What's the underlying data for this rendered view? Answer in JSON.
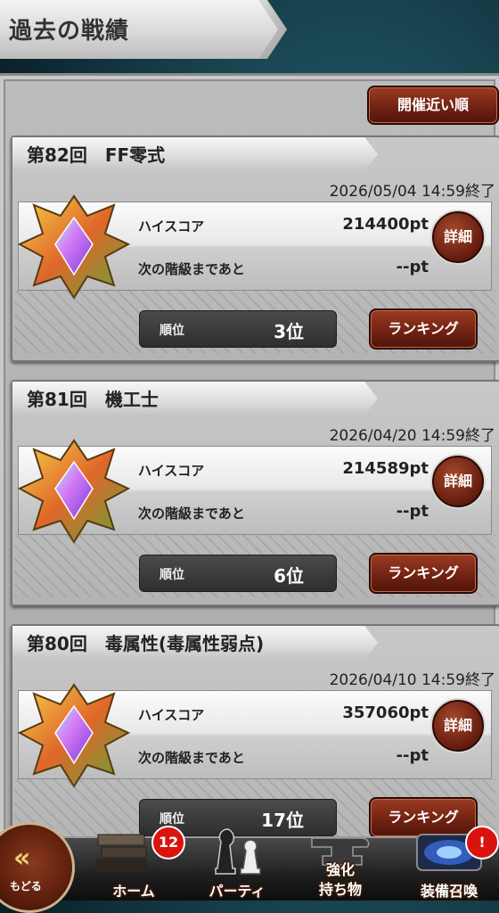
{
  "header": {
    "title": "過去の戦績"
  },
  "sort_button": {
    "label": "開催近い順"
  },
  "labels": {
    "high_score": "ハイスコア",
    "next_rank": "次の階級まであと",
    "rank": "順位",
    "detail": "詳細",
    "ranking": "ランキング"
  },
  "events": [
    {
      "title": "第82回　FF零式",
      "date": "2026/05/04 14:59終了",
      "high_score": "214400pt",
      "next_rank": "--pt",
      "rank": "3位"
    },
    {
      "title": "第81回　機工士",
      "date": "2026/04/20 14:59終了",
      "high_score": "214589pt",
      "next_rank": "--pt",
      "rank": "6位"
    },
    {
      "title": "第80回　毒属性(毒属性弱点)",
      "date": "2026/04/10 14:59終了",
      "high_score": "357060pt",
      "next_rank": "--pt",
      "rank": "17位"
    }
  ],
  "nav": {
    "back": "もどる",
    "home": "ホーム",
    "home_badge": "12",
    "party": "パーティ",
    "enhance_line1": "強化",
    "enhance_line2": "持ち物",
    "summon": "装備召喚",
    "summon_badge": "!"
  }
}
